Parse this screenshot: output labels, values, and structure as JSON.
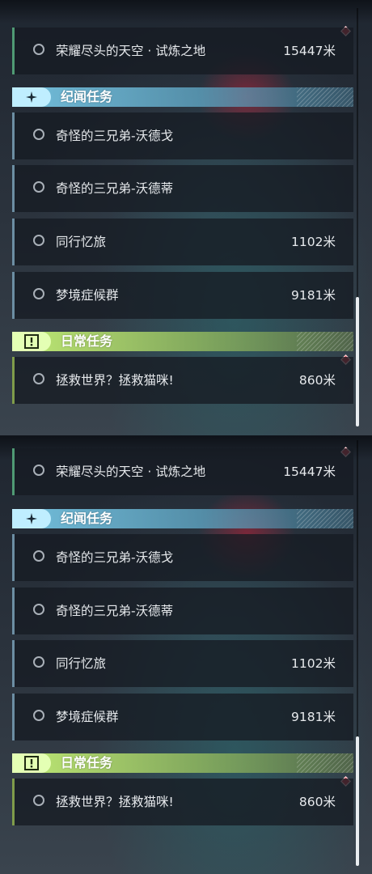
{
  "screen1": {
    "top_quest": {
      "name": "荣耀尽头的天空 · 试炼之地",
      "distance": "15447米"
    },
    "categories": [
      {
        "title": "纪闻任务",
        "icon": "sparkle-icon",
        "quests": [
          {
            "name": "奇怪的三兄弟-沃德戈",
            "distance": ""
          },
          {
            "name": "奇怪的三兄弟-沃德蒂",
            "distance": ""
          },
          {
            "name": "同行忆旅",
            "distance": "1102米"
          },
          {
            "name": "梦境症候群",
            "distance": "9181米"
          }
        ]
      },
      {
        "title": "日常任务",
        "icon": "exclamation-box-icon",
        "quests": [
          {
            "name": "拯救世界？拯救猫咪!",
            "distance": "860米"
          }
        ]
      }
    ]
  },
  "screen2": {
    "top_quest": {
      "name": "荣耀尽头的天空 · 试炼之地",
      "distance": "15447米"
    },
    "categories": [
      {
        "title": "纪闻任务",
        "icon": "sparkle-icon",
        "quests": [
          {
            "name": "奇怪的三兄弟-沃德戈",
            "distance": ""
          },
          {
            "name": "奇怪的三兄弟-沃德蒂",
            "distance": ""
          },
          {
            "name": "同行忆旅",
            "distance": "1102米"
          },
          {
            "name": "梦境症候群",
            "distance": "9181米"
          }
        ]
      },
      {
        "title": "日常任务",
        "icon": "exclamation-box-icon",
        "quests": [
          {
            "name": "拯救世界？拯救猫咪!",
            "distance": "860米"
          }
        ]
      }
    ]
  },
  "colors": {
    "accent_world": "#78c8e6",
    "accent_daily": "#c8f578",
    "marker": "#e0414f"
  }
}
